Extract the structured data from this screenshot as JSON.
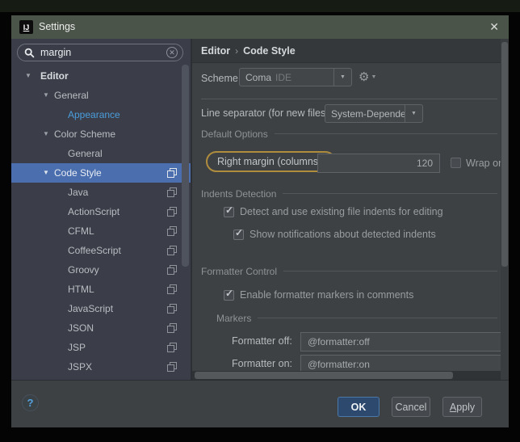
{
  "icons": {
    "chevron_down": "▼",
    "dropdown_arrow": "▼",
    "close": "✕",
    "clear": "✕",
    "gear": "⚙",
    "check": "✓",
    "breadcrumb_separator": "›",
    "help": "?"
  },
  "window": {
    "logo": "IJ",
    "title": "Settings"
  },
  "search": {
    "value": "margin"
  },
  "sidebar": {
    "items": [
      "Editor",
      "General",
      "Appearance",
      "Color Scheme",
      "General",
      "Code Style",
      "Java",
      "ActionScript",
      "CFML",
      "CoffeeScript",
      "Groovy",
      "HTML",
      "JavaScript",
      "JSON",
      "JSP",
      "JSPX"
    ]
  },
  "content": {
    "breadcrumb": {
      "parent": "Editor",
      "current": "Code Style"
    },
    "scheme": {
      "label": "Scheme:",
      "value": "Coma",
      "suffix": "IDE"
    },
    "line_separator": {
      "label": "Line separator (for new files):",
      "value": "System-Dependent"
    },
    "default_options": {
      "title": "Default Options",
      "right_margin_label": "Right margin (columns):",
      "right_margin_value": "120",
      "wrap_on_typing_label": "Wrap on t"
    },
    "indents_detection": {
      "title": "Indents Detection",
      "detect_label": "Detect and use existing file indents for editing",
      "notify_label": "Show notifications about detected indents"
    },
    "formatter_control": {
      "title": "Formatter Control",
      "enable_label": "Enable formatter markers in comments"
    },
    "markers": {
      "title": "Markers",
      "off_label": "Formatter off:",
      "off_value": "@formatter:off",
      "on_label": "Formatter on:",
      "on_value": "@formatter:on"
    }
  },
  "footer": {
    "help": "?",
    "ok": "OK",
    "cancel": "Cancel",
    "apply_accel": "A",
    "apply_rest": "pply"
  }
}
